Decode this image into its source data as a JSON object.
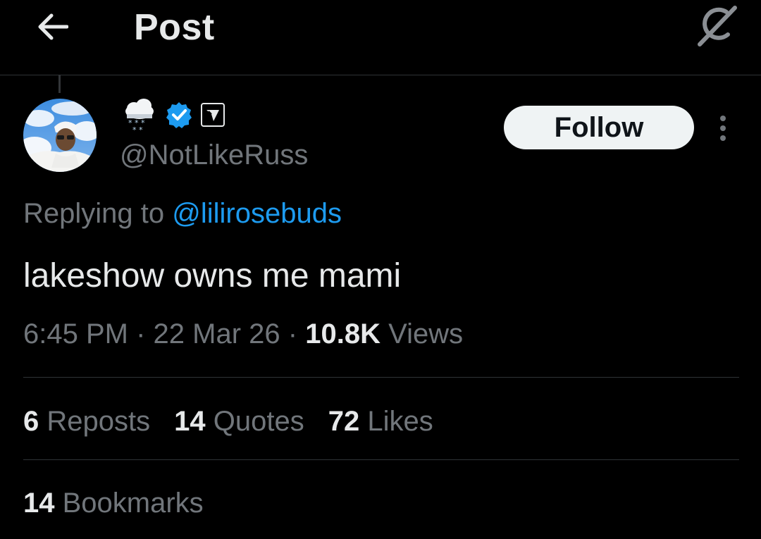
{
  "header": {
    "title": "Post",
    "back_icon": "arrow-left-icon",
    "grok_icon": "grok-icon"
  },
  "author": {
    "display_name_emoji": "🌨",
    "handle": "@NotLikeRuss",
    "verified": true,
    "affiliation_badge": "affiliate-badge-icon",
    "follow_label": "Follow"
  },
  "post": {
    "replying_prefix": "Replying to",
    "replying_to": "@lilirosebuds",
    "text": "lakeshow owns me mami",
    "time": "6:45 PM",
    "date": "22 Mar 26",
    "separator": "·",
    "views_count": "10.8K",
    "views_label": "Views"
  },
  "stats": [
    {
      "count": "6",
      "label": "Reposts"
    },
    {
      "count": "14",
      "label": "Quotes"
    },
    {
      "count": "72",
      "label": "Likes"
    }
  ],
  "bookmarks": {
    "count": "14",
    "label": "Bookmarks"
  },
  "colors": {
    "background": "#000000",
    "text_primary": "#e7e9ea",
    "text_secondary": "#71767b",
    "accent": "#1d9bf0",
    "divider": "#2f3336",
    "follow_bg": "#eff3f4"
  }
}
